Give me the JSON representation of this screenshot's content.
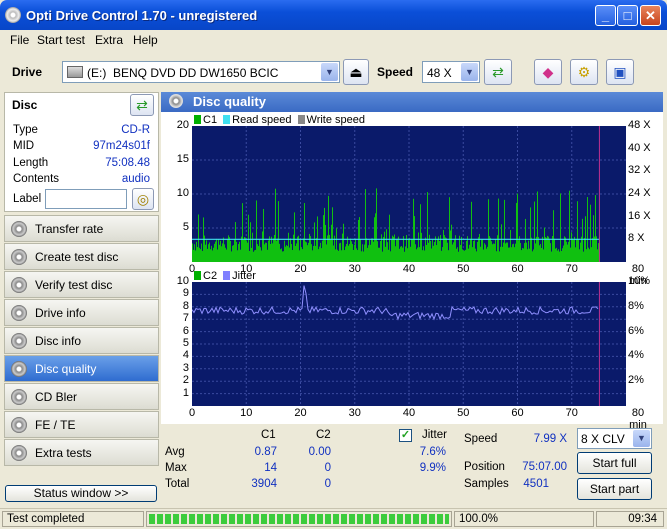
{
  "window": {
    "title": "Opti Drive Control 1.70 - unregistered"
  },
  "menu": [
    "File",
    "Start test",
    "Extra",
    "Help"
  ],
  "toolbar": {
    "drive_label": "Drive",
    "drive_letter": "(E:)",
    "drive_value": "BENQ DVD DD DW1650 BCIC",
    "speed_label": "Speed",
    "speed_value": "48 X"
  },
  "disc": {
    "header": "Disc",
    "rows": [
      {
        "k": "Type",
        "v": "CD-R"
      },
      {
        "k": "MID",
        "v": "97m24s01f"
      },
      {
        "k": "Length",
        "v": "75:08.48"
      },
      {
        "k": "Contents",
        "v": "audio"
      }
    ],
    "label_caption": "Label",
    "label_value": ""
  },
  "nav": [
    "Transfer rate",
    "Create test disc",
    "Verify test disc",
    "Drive info",
    "Disc info",
    "Disc quality",
    "CD Bler",
    "FE / TE",
    "Extra tests"
  ],
  "nav_active": 5,
  "status_window_button": "Status window >>",
  "panel": {
    "title": "Disc quality"
  },
  "top_chart": {
    "legend": [
      "C1",
      "Read speed",
      "Write speed"
    ],
    "y_left": [
      "20",
      "15",
      "10",
      "5"
    ],
    "y_right": [
      "48 X",
      "40 X",
      "32 X",
      "24 X",
      "16 X",
      "8 X"
    ],
    "x": [
      "0",
      "10",
      "20",
      "30",
      "40",
      "50",
      "60",
      "70",
      "80 min"
    ]
  },
  "bottom_chart": {
    "legend": [
      "C2",
      "Jitter"
    ],
    "y_left": [
      "10",
      "9",
      "8",
      "7",
      "6",
      "5",
      "4",
      "3",
      "2",
      "1"
    ],
    "y_right": [
      "10%",
      "8%",
      "6%",
      "4%",
      "2%"
    ],
    "x": [
      "0",
      "10",
      "20",
      "30",
      "40",
      "50",
      "60",
      "70",
      "80 min"
    ]
  },
  "chart_data": [
    {
      "type": "bar",
      "title": "",
      "series": [
        {
          "name": "C1",
          "note": "dense spikes",
          "max": 14,
          "avg": 0.87
        },
        {
          "name": "Read speed",
          "value_x": 8
        }
      ],
      "xlabel": "min",
      "xlim": [
        0,
        80
      ],
      "ylim": [
        0,
        20
      ],
      "y2lim": [
        0,
        48
      ]
    },
    {
      "type": "line",
      "series": [
        {
          "name": "C2",
          "max": 0,
          "avg": 0
        },
        {
          "name": "Jitter",
          "avg": 7.6,
          "max": 9.9,
          "unit": "%"
        }
      ],
      "xlim": [
        0,
        80
      ],
      "ylim": [
        0,
        10
      ]
    }
  ],
  "stats": {
    "col_c1": "C1",
    "col_c2": "C2",
    "rows": [
      {
        "k": "Avg",
        "c1": "0.87",
        "c2": "0.00"
      },
      {
        "k": "Max",
        "c1": "14",
        "c2": "0"
      },
      {
        "k": "Total",
        "c1": "3904",
        "c2": "0"
      }
    ],
    "jitter_label": "Jitter",
    "jitter_avg": "7.6%",
    "jitter_max": "9.9%",
    "speed_label": "Speed",
    "speed_value": "7.99 X",
    "position_label": "Position",
    "position_value": "75:07.00",
    "samples_label": "Samples",
    "samples_value": "4501",
    "speed_mode": "8 X CLV",
    "start_full": "Start full",
    "start_part": "Start part"
  },
  "statusbar": {
    "text": "Test completed",
    "progress": 1.0,
    "progress_text": "100.0%",
    "time": "09:34"
  }
}
